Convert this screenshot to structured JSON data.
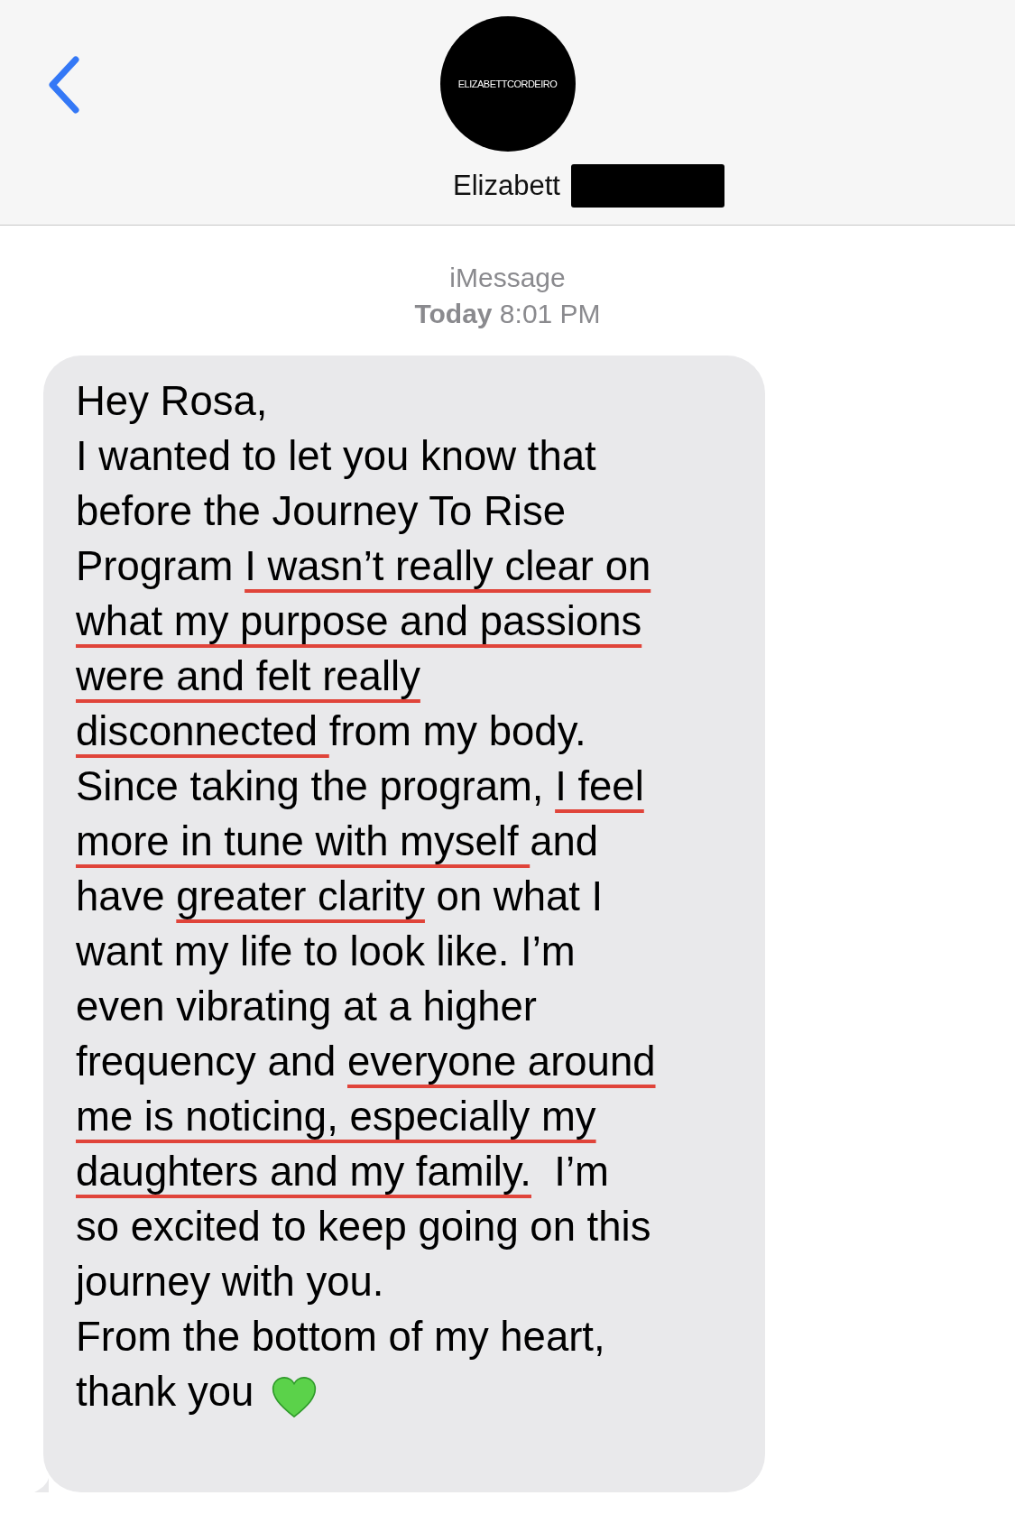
{
  "header": {
    "avatar_text": "ELIZABETTCORDEIRO",
    "contact_name": "Elizabett"
  },
  "meta": {
    "service": "iMessage",
    "time": "**Today** 8:01 PM"
  },
  "message": {
    "lines": [
      [
        {
          "text": "Hey Rosa,",
          "underlined": false
        }
      ],
      [
        {
          "text": "I wanted to let you know that",
          "underlined": false
        }
      ],
      [
        {
          "text": "before the Journey To Rise",
          "underlined": false
        }
      ],
      [
        {
          "text": "Program ",
          "underlined": false
        },
        {
          "text": "I wasn’t really clear on",
          "underlined": true
        }
      ],
      [
        {
          "text": "what my purpose and passions",
          "underlined": true
        }
      ],
      [
        {
          "text": "were and felt really",
          "underlined": true
        }
      ],
      [
        {
          "text": "disconnected ",
          "underlined": true
        },
        {
          "text": "from my body.",
          "underlined": false
        }
      ],
      [
        {
          "text": "Since taking the program, ",
          "underlined": false
        },
        {
          "text": "I feel",
          "underlined": true
        }
      ],
      [
        {
          "text": "more in tune with myself ",
          "underlined": true
        },
        {
          "text": "and",
          "underlined": false
        }
      ],
      [
        {
          "text": "have ",
          "underlined": false
        },
        {
          "text": "greater clarity",
          "underlined": true
        },
        {
          "text": " on what I",
          "underlined": false
        }
      ],
      [
        {
          "text": "want my life to look like. I’m",
          "underlined": false
        }
      ],
      [
        {
          "text": "even vibrating at a higher",
          "underlined": false
        }
      ],
      [
        {
          "text": "frequency and ",
          "underlined": false
        },
        {
          "text": "everyone around",
          "underlined": true
        }
      ],
      [
        {
          "text": "me is noticing, especially my",
          "underlined": true
        }
      ],
      [
        {
          "text": "daughters and my family.",
          "underlined": true
        },
        {
          "text": "  I’m",
          "underlined": false
        }
      ],
      [
        {
          "text": "so excited to keep going on this",
          "underlined": false
        }
      ],
      [
        {
          "text": "journey with you.",
          "underlined": false
        }
      ],
      [
        {
          "text": "From the bottom of my heart,",
          "underlined": false
        }
      ],
      [
        {
          "text": "thank you",
          "underlined": false
        }
      ]
    ]
  }
}
